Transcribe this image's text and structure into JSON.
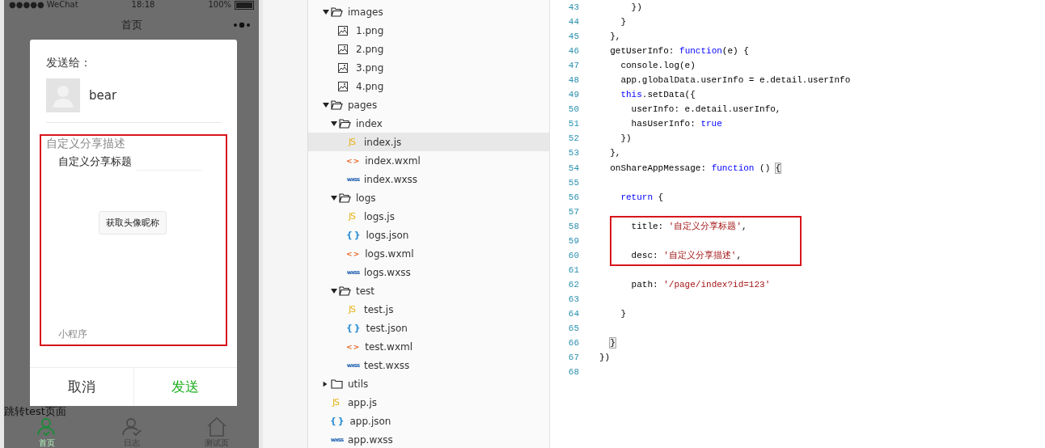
{
  "phone": {
    "status_bar": {
      "carrier": "●●●●● WeChat",
      "time": "18:18",
      "battery": "100%"
    },
    "nav_title": "首页",
    "page_link": "跳转test页面",
    "tabs": [
      {
        "label": "首页",
        "selected": true,
        "kind": "person"
      },
      {
        "label": "日志",
        "selected": false,
        "kind": "person-check"
      },
      {
        "label": "测试页",
        "selected": false,
        "kind": "house"
      }
    ],
    "share_dialog": {
      "heading": "发送给：",
      "recipient": "bear",
      "description": "自定义分享描述",
      "title": "自定义分享标题",
      "action_button": "获取头像昵称",
      "footer": "小程序",
      "cancel": "取消",
      "send": "发送"
    }
  },
  "file_tree": [
    {
      "name": "images",
      "kind": "folder",
      "expanded": true,
      "selected": false,
      "children": [
        {
          "name": "1.png",
          "kind": "image",
          "selected": false
        },
        {
          "name": "2.png",
          "kind": "image",
          "selected": false
        },
        {
          "name": "3.png",
          "kind": "image",
          "selected": false
        },
        {
          "name": "4.png",
          "kind": "image",
          "selected": false
        }
      ]
    },
    {
      "name": "pages",
      "kind": "folder",
      "expanded": true,
      "selected": false,
      "children": [
        {
          "name": "index",
          "kind": "folder",
          "expanded": true,
          "selected": false,
          "children": [
            {
              "name": "index.js",
              "kind": "js",
              "icon": "JS",
              "selected": true
            },
            {
              "name": "index.wxml",
              "kind": "wxml",
              "icon": "< >",
              "selected": false
            },
            {
              "name": "index.wxss",
              "kind": "wxss",
              "icon": "wxss",
              "selected": false
            }
          ]
        },
        {
          "name": "logs",
          "kind": "folder",
          "expanded": true,
          "selected": false,
          "children": [
            {
              "name": "logs.js",
              "kind": "js",
              "icon": "JS",
              "selected": false
            },
            {
              "name": "logs.json",
              "kind": "json",
              "icon": "{ }",
              "selected": false
            },
            {
              "name": "logs.wxml",
              "kind": "wxml",
              "icon": "< >",
              "selected": false
            },
            {
              "name": "logs.wxss",
              "kind": "wxss",
              "icon": "wxss",
              "selected": false
            }
          ]
        },
        {
          "name": "test",
          "kind": "folder",
          "expanded": true,
          "selected": false,
          "children": [
            {
              "name": "test.js",
              "kind": "js",
              "icon": "JS",
              "selected": false
            },
            {
              "name": "test.json",
              "kind": "json",
              "icon": "{ }",
              "selected": false
            },
            {
              "name": "test.wxml",
              "kind": "wxml",
              "icon": "< >",
              "selected": false
            },
            {
              "name": "test.wxss",
              "kind": "wxss",
              "icon": "wxss",
              "selected": false
            }
          ]
        }
      ]
    },
    {
      "name": "utils",
      "kind": "folder",
      "expanded": false,
      "selected": false
    },
    {
      "name": "app.js",
      "kind": "js",
      "icon": "JS",
      "selected": false
    },
    {
      "name": "app.json",
      "kind": "json",
      "icon": "{ }",
      "selected": false
    },
    {
      "name": "app.wxss",
      "kind": "wxss",
      "icon": "wxss",
      "selected": false
    }
  ],
  "code": [
    {
      "number": "43",
      "tokens": [
        {
          "text": "      })",
          "kind": "plain"
        }
      ]
    },
    {
      "number": "44",
      "tokens": [
        {
          "text": "    }",
          "kind": "plain"
        }
      ]
    },
    {
      "number": "45",
      "tokens": [
        {
          "text": "  },",
          "kind": "plain"
        }
      ]
    },
    {
      "number": "46",
      "tokens": [
        {
          "text": "  getUserInfo: ",
          "kind": "plain"
        },
        {
          "text": "function",
          "kind": "keyword"
        },
        {
          "text": "(e) {",
          "kind": "plain"
        }
      ]
    },
    {
      "number": "47",
      "tokens": [
        {
          "text": "    console.log(e)",
          "kind": "plain"
        }
      ]
    },
    {
      "number": "48",
      "tokens": [
        {
          "text": "    app.globalData.userInfo = e.detail.userInfo",
          "kind": "plain"
        }
      ]
    },
    {
      "number": "49",
      "tokens": [
        {
          "text": "    this",
          "kind": "keyword"
        },
        {
          "text": ".setData({",
          "kind": "plain"
        }
      ]
    },
    {
      "number": "50",
      "tokens": [
        {
          "text": "      userInfo: e.detail.userInfo,",
          "kind": "plain"
        }
      ]
    },
    {
      "number": "51",
      "tokens": [
        {
          "text": "      hasUserInfo: ",
          "kind": "plain"
        },
        {
          "text": "true",
          "kind": "keyword"
        }
      ]
    },
    {
      "number": "52",
      "tokens": [
        {
          "text": "    })",
          "kind": "plain"
        }
      ]
    },
    {
      "number": "53",
      "tokens": [
        {
          "text": "  },",
          "kind": "plain"
        }
      ]
    },
    {
      "number": "54",
      "tokens": [
        {
          "text": "  onShareAppMessage: ",
          "kind": "plain"
        },
        {
          "text": "function",
          "kind": "keyword"
        },
        {
          "text": " () ",
          "kind": "plain"
        },
        {
          "text": "{",
          "kind": "bracket"
        }
      ]
    },
    {
      "number": "55"
    },
    {
      "number": "56",
      "tokens": [
        {
          "text": "    return",
          "kind": "keyword"
        },
        {
          "text": " {",
          "kind": "plain"
        }
      ]
    },
    {
      "number": "57"
    },
    {
      "number": "58",
      "highlighted": true,
      "tokens": [
        {
          "text": "      title: ",
          "kind": "plain"
        },
        {
          "text": "'自定义分享标题'",
          "kind": "string"
        },
        {
          "text": ",",
          "kind": "plain"
        }
      ]
    },
    {
      "number": "59",
      "highlighted": true
    },
    {
      "number": "60",
      "highlighted": true,
      "tokens": [
        {
          "text": "      desc: ",
          "kind": "plain"
        },
        {
          "text": "'自定义分享描述'",
          "kind": "string"
        },
        {
          "text": ",",
          "kind": "plain"
        }
      ]
    },
    {
      "number": "61"
    },
    {
      "number": "62",
      "tokens": [
        {
          "text": "      path: ",
          "kind": "plain"
        },
        {
          "text": "'/page/index?id=123'",
          "kind": "string"
        }
      ]
    },
    {
      "number": "63"
    },
    {
      "number": "64",
      "tokens": [
        {
          "text": "    }",
          "kind": "plain"
        }
      ]
    },
    {
      "number": "65"
    },
    {
      "number": "66",
      "tokens": [
        {
          "text": "  }",
          "kind": "bracket"
        }
      ]
    },
    {
      "number": "67",
      "tokens": [
        {
          "text": "})",
          "kind": "plain"
        }
      ]
    },
    {
      "number": "68"
    }
  ]
}
